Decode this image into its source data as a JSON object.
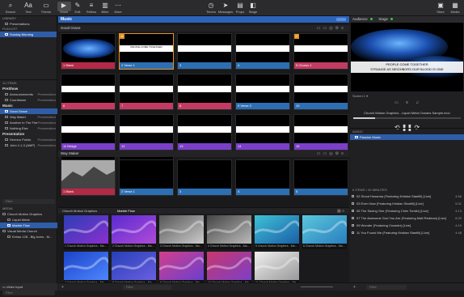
{
  "toolbar": {
    "left_items": [
      {
        "label": "Search",
        "icon": "search-icon"
      },
      {
        "label": "Text",
        "icon": "text-icon"
      },
      {
        "label": "Theme",
        "icon": "theme-icon"
      }
    ],
    "mode_items": [
      {
        "label": "Show",
        "icon": "play-icon"
      },
      {
        "label": "Edit",
        "icon": "edit-icon"
      },
      {
        "label": "Reflow",
        "icon": "reflow-icon"
      },
      {
        "label": "Bible",
        "icon": "bible-icon"
      },
      {
        "label": "More",
        "icon": "more-icon"
      }
    ],
    "center_items": [
      {
        "label": "Timers",
        "icon": "timer-icon"
      },
      {
        "label": "Messages",
        "icon": "message-icon"
      },
      {
        "label": "Props",
        "icon": "props-icon"
      },
      {
        "label": "Stage",
        "icon": "stage-icon"
      }
    ],
    "right_items": [
      {
        "label": "Store",
        "icon": "store-icon"
      },
      {
        "label": "Media",
        "icon": "media-icon"
      }
    ]
  },
  "library": {
    "header": "LIBRARY",
    "items": [
      {
        "label": "Presentations"
      }
    ],
    "playlist_header": "PLAYLIST",
    "playlists": [
      {
        "label": "Sunday Morning",
        "selected": true
      }
    ]
  },
  "playlist_items": {
    "header": "11 ITEMS",
    "groups": [
      {
        "name": "PreShow",
        "items": [
          {
            "label": "Announcements",
            "meta": "Presentation"
          },
          {
            "label": "Countdown",
            "meta": "Presentation"
          }
        ]
      },
      {
        "name": "Music",
        "items": [
          {
            "label": "Good Grace",
            "meta": "",
            "selected": true
          },
          {
            "label": "Way Maker",
            "meta": "Presentation"
          },
          {
            "label": "Another In The Fire",
            "meta": "Presentation"
          },
          {
            "label": "Nothing Else",
            "meta": "Presentation"
          }
        ]
      },
      {
        "name": "Presentation",
        "items": [
          {
            "label": "Sermon Points",
            "meta": "Presentation"
          },
          {
            "label": "John 1:1-3 (AMP)",
            "meta": "Presentation"
          }
        ]
      }
    ],
    "filter_placeholder": "Filter"
  },
  "media_library": {
    "header": "MEDIA",
    "items": [
      {
        "label": "Church Motion Graphics",
        "level": 0
      },
      {
        "label": "Liquid Metal",
        "level": 1
      },
      {
        "label": "Marble Flow",
        "level": 1,
        "selected": true
      },
      {
        "label": "Visual Media Church",
        "level": 0
      },
      {
        "label": "Extras 128 - Big Icons - M...",
        "level": 1
      }
    ],
    "filter_placeholder": "Filter",
    "video_input_label": "Video Input"
  },
  "center": {
    "section_title": "Music",
    "songs": [
      {
        "title": "Good Grace",
        "slides": [
          {
            "num": "1",
            "label": "Blank",
            "group": "blank",
            "letter": "",
            "lyric": ""
          },
          {
            "num": "2",
            "label": "Verse 1",
            "group": "verse",
            "letter": "A",
            "lyric": "PEOPLE COME TOGETHER"
          },
          {
            "num": "3",
            "label": "",
            "group": "verse",
            "letter": "",
            "lyric": ""
          },
          {
            "num": "4",
            "label": "",
            "group": "verse",
            "letter": "",
            "lyric": ""
          },
          {
            "num": "5",
            "label": "Chorus 1",
            "group": "chorus",
            "letter": "C",
            "lyric": ""
          },
          {
            "num": "6",
            "label": "",
            "group": "chorus",
            "letter": "",
            "lyric": ""
          },
          {
            "num": "7",
            "label": "",
            "group": "chorus",
            "letter": "",
            "lyric": ""
          },
          {
            "num": "8",
            "label": "",
            "group": "chorus",
            "letter": "",
            "lyric": ""
          },
          {
            "num": "9",
            "label": "Verse 2",
            "group": "verse",
            "letter": "",
            "lyric": ""
          },
          {
            "num": "10",
            "label": "",
            "group": "verse",
            "letter": "",
            "lyric": ""
          },
          {
            "num": "11",
            "label": "Bridge",
            "group": "bridge",
            "letter": "",
            "lyric": ""
          },
          {
            "num": "12",
            "label": "",
            "group": "bridge",
            "letter": "",
            "lyric": ""
          },
          {
            "num": "13",
            "label": "",
            "group": "bridge",
            "letter": "",
            "lyric": ""
          },
          {
            "num": "14",
            "label": "",
            "group": "bridge",
            "letter": "",
            "lyric": ""
          },
          {
            "num": "15",
            "label": "",
            "group": "bridge",
            "letter": "",
            "lyric": ""
          },
          {
            "num": "16",
            "label": "",
            "group": "bridge",
            "letter": "",
            "lyric": ""
          },
          {
            "num": "17",
            "label": "",
            "group": "bridge",
            "letter": "",
            "lyric": ""
          }
        ]
      },
      {
        "title": "Way Maker",
        "slides": [
          {
            "num": "1",
            "label": "Blank",
            "group": "blank"
          },
          {
            "num": "2",
            "label": "Verse 1",
            "group": "verse"
          },
          {
            "num": "3",
            "label": "",
            "group": "verse"
          },
          {
            "num": "4",
            "label": "",
            "group": "verse"
          },
          {
            "num": "5",
            "label": "",
            "group": "verse"
          }
        ]
      }
    ],
    "media_tabs": [
      "Church Motion Graphics",
      "Marble Flow"
    ],
    "media_thumbs": [
      {
        "caption": "1 Church Motion Graphics - Ma..."
      },
      {
        "caption": "2 Church Motion Graphics - Ma..."
      },
      {
        "caption": "3 Church Motion Graphics - Ma..."
      },
      {
        "caption": "4 Church Motion Graphics - Ma..."
      },
      {
        "caption": "5 Church Motion Graphics - Ma..."
      },
      {
        "caption": "6 Church Motion Graphics - Ma..."
      },
      {
        "caption": "7 Church Motion Graphics - Ma..."
      },
      {
        "caption": "8 Church Motion Graphics - Ma..."
      },
      {
        "caption": "9 Church Motion Graphics - Ma..."
      },
      {
        "caption": "10 Church Motion Graphics - Ma..."
      },
      {
        "caption": "11 Church Motion Graphics - Ma..."
      }
    ],
    "filter_placeholder": "Filter"
  },
  "right": {
    "tabs": [
      "Audience",
      "Stage"
    ],
    "preview_lyric_line1": "PEOPLE COME TOGETHER",
    "preview_lyric_line2": "STRANGE AS NEIGHBORS OUR BLOOD IS ONE",
    "screen_label": "Screen 1",
    "now_playing": "Church Motion Graphics - Liquid Metal Oceans Sample.mov",
    "audio_header": "AUDIO",
    "audio_playlist": "Passion Music",
    "playlist_count": "6 ITEMS • 30 MINUTES",
    "tracks": [
      {
        "title": "02 Shout Hosanna (Featuring Kristian Stanfill) [Live]",
        "dur": "4:56"
      },
      {
        "title": "03 Even Now (Featuring Kristian Stanfill) [Live]",
        "dur": "5:31"
      },
      {
        "title": "06 The Saving One (Featuring Chris Tomlin) [Live]",
        "dur": "4:13"
      },
      {
        "title": "07 The Awesome God You Are (Featuring Matt Redman) [Live]",
        "dur": "6:29"
      },
      {
        "title": "09 Wonder (Featuring Crowder) [Live]",
        "dur": "4:19"
      },
      {
        "title": "11 You Found Me (Featuring Kristian Stanfill) [Live]",
        "dur": "4:48"
      }
    ],
    "filter_placeholder": "Filter"
  },
  "colors": {
    "accent_blue": "#2d63b8",
    "blank_group": "#b32a47",
    "verse_group": "#2d6fb3",
    "chorus_group": "#c23b62",
    "bridge_group": "#7c3fc8",
    "live_green": "#3fc24a",
    "selected_orange": "#e39426"
  }
}
